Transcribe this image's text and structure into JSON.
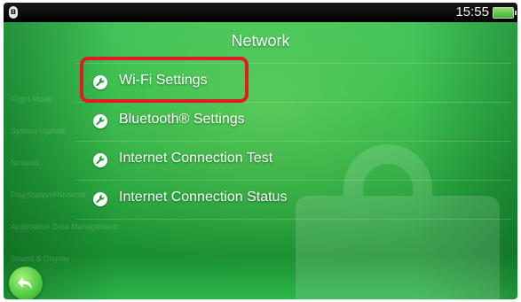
{
  "status_bar": {
    "bluetooth_icon": "bluetooth-icon",
    "time": "15:55",
    "battery_icon": "battery-icon"
  },
  "header": {
    "title": "Network"
  },
  "menu": {
    "items": [
      {
        "label": "Wi-Fi Settings",
        "icon": "wrench-icon",
        "highlighted": true
      },
      {
        "label": "Bluetooth® Settings",
        "icon": "wrench-icon"
      },
      {
        "label": "Internet Connection Test",
        "icon": "wrench-icon"
      },
      {
        "label": "Internet Connection Status",
        "icon": "wrench-icon"
      }
    ]
  },
  "background_menu": {
    "items": [
      "Flight Mode",
      "System Update",
      "Network",
      "PlayStation®Network",
      "Application Data Management",
      "Sound & Display"
    ]
  },
  "footer": {
    "back_icon": "back-arrow-icon"
  },
  "colors": {
    "accent_green": "#2db84b",
    "highlight_red": "#e21a24",
    "status_bar": "#000000"
  }
}
